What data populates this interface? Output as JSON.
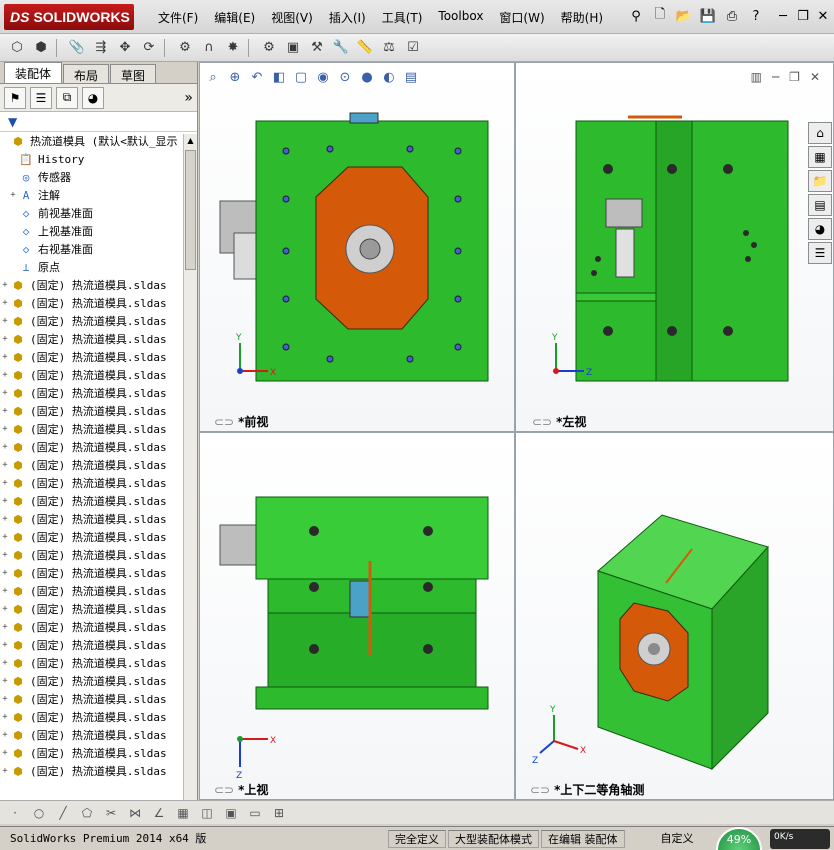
{
  "app": {
    "logo_prefix": "DS",
    "logo_text": "SOLIDWORKS",
    "colors": {
      "accent": "#c61b1b",
      "mold_green": "#2dba2d",
      "cavity_orange": "#d45a0a",
      "axis_x": "#d61a1a",
      "axis_y": "#1a9c2a",
      "axis_z": "#1a3fd0"
    }
  },
  "menu": {
    "items": [
      "文件(F)",
      "编辑(E)",
      "视图(V)",
      "插入(I)",
      "工具(T)",
      "Toolbox",
      "窗口(W)",
      "帮助(H)"
    ]
  },
  "left_panel": {
    "tabs": [
      "装配体",
      "布局",
      "草图"
    ],
    "filter_icon": "filter-icon",
    "root": "热流道模具  (默认<默认_显示",
    "children": [
      {
        "label": "History",
        "icon": "history-icon"
      },
      {
        "label": "传感器",
        "icon": "sensor-icon"
      },
      {
        "label": "注解",
        "icon": "annotation-icon"
      },
      {
        "label": "前视基准面",
        "icon": "plane-icon"
      },
      {
        "label": "上视基准面",
        "icon": "plane-icon"
      },
      {
        "label": "右视基准面",
        "icon": "plane-icon"
      },
      {
        "label": "原点",
        "icon": "origin-icon"
      }
    ],
    "part_label": "(固定) 热流道模具.sldas",
    "part_count": 28
  },
  "viewports": {
    "front": "*前视",
    "left": "*左视",
    "top": "*上视",
    "iso": "*上下二等角轴测"
  },
  "status": {
    "product": "SolidWorks Premium 2014 x64 版",
    "fully_defined": "完全定义",
    "large_assembly": "大型装配体模式",
    "editing": "在编辑 装配体",
    "custom": "自定义",
    "gauge": "49%",
    "speed": "0K/s"
  }
}
